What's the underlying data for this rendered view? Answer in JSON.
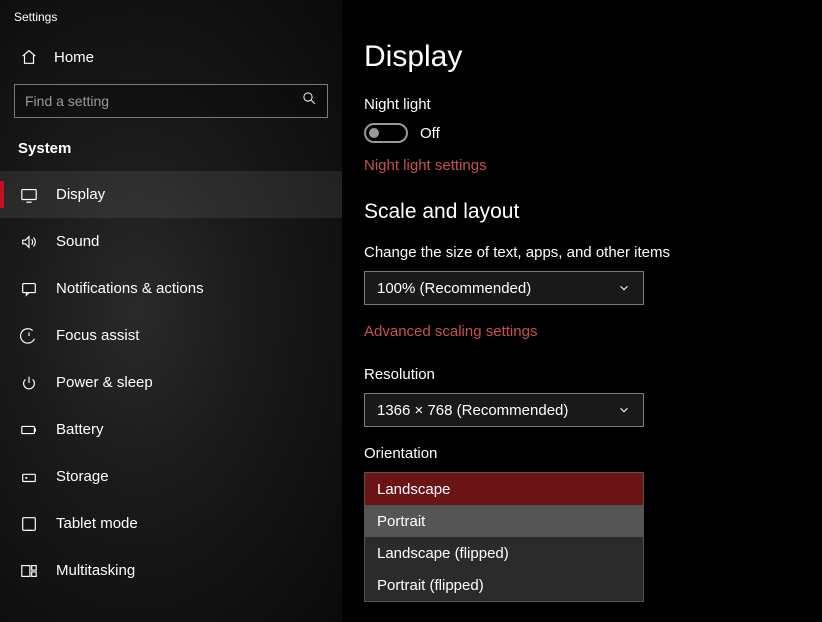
{
  "appTitle": "Settings",
  "home": {
    "label": "Home"
  },
  "search": {
    "placeholder": "Find a setting"
  },
  "category": "System",
  "navItems": [
    {
      "label": "Display",
      "active": true
    },
    {
      "label": "Sound"
    },
    {
      "label": "Notifications & actions"
    },
    {
      "label": "Focus assist"
    },
    {
      "label": "Power & sleep"
    },
    {
      "label": "Battery"
    },
    {
      "label": "Storage"
    },
    {
      "label": "Tablet mode"
    },
    {
      "label": "Multitasking"
    }
  ],
  "main": {
    "title": "Display",
    "nightLight": {
      "label": "Night light",
      "state": "Off",
      "settingsLink": "Night light settings"
    },
    "scaleLayout": {
      "title": "Scale and layout",
      "scale": {
        "label": "Change the size of text, apps, and other items",
        "value": "100% (Recommended)"
      },
      "advancedLink": "Advanced scaling settings",
      "resolution": {
        "label": "Resolution",
        "value": "1366 × 768 (Recommended)"
      },
      "orientation": {
        "label": "Orientation",
        "options": [
          "Landscape",
          "Portrait",
          "Landscape (flipped)",
          "Portrait (flipped)"
        ],
        "selectedIndex": 0,
        "hoverIndex": 1
      }
    }
  }
}
